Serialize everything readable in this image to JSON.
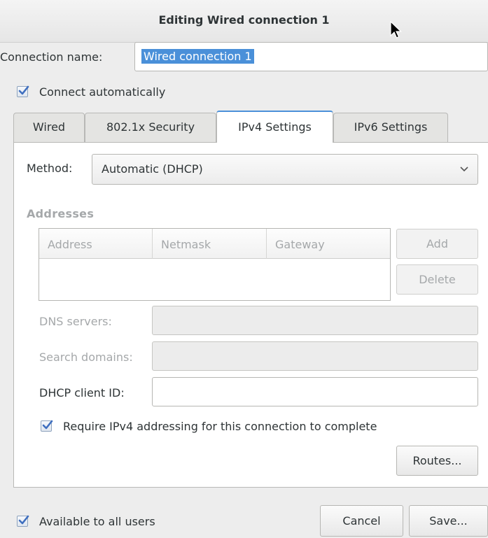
{
  "window": {
    "title": "Editing Wired connection 1"
  },
  "connection_name": {
    "label": "Connection name:",
    "value": "Wired connection 1"
  },
  "connect_automatically": {
    "label": "Connect automatically",
    "checked": true
  },
  "tabs": [
    {
      "label": "Wired",
      "active": false
    },
    {
      "label": "802.1x Security",
      "active": false
    },
    {
      "label": "IPv4 Settings",
      "active": true
    },
    {
      "label": "IPv6 Settings",
      "active": false
    }
  ],
  "ipv4": {
    "method_label": "Method:",
    "method_value": "Automatic (DHCP)",
    "addresses_heading": "Addresses",
    "columns": [
      "Address",
      "Netmask",
      "Gateway"
    ],
    "add_label": "Add",
    "delete_label": "Delete",
    "dns_label": "DNS servers:",
    "dns_value": "",
    "search_label": "Search domains:",
    "search_value": "",
    "dhcp_label": "DHCP client ID:",
    "dhcp_value": "",
    "require_label": "Require IPv4 addressing for this connection to complete",
    "require_checked": true,
    "routes_label": "Routes..."
  },
  "footer": {
    "available_label": "Available to all users",
    "available_checked": true,
    "cancel_label": "Cancel",
    "save_label": "Save..."
  },
  "colors": {
    "accent": "#4a90d9",
    "disabled_text": "#a5a8aa"
  }
}
